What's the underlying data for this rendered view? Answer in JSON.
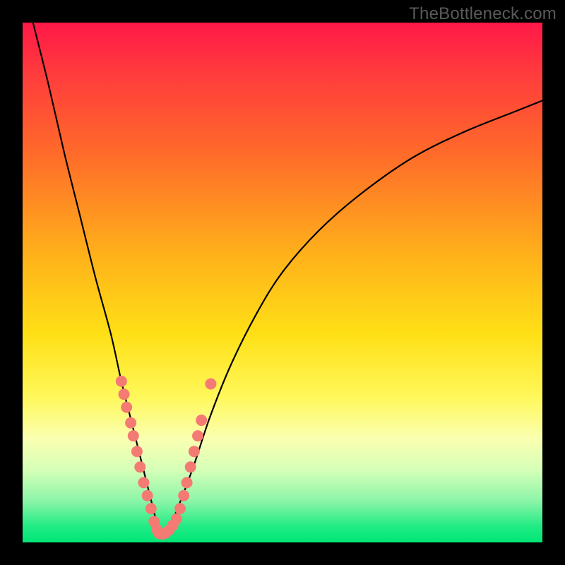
{
  "watermark": "TheBottleneck.com",
  "colors": {
    "frame": "#000000",
    "curve": "#000000",
    "dot": "#f47b73",
    "gradient_top": "#ff1848",
    "gradient_bottom": "#00e676"
  },
  "chart_data": {
    "type": "line",
    "title": "",
    "xlabel": "",
    "ylabel": "",
    "xlim": [
      0,
      100
    ],
    "ylim": [
      0,
      100
    ],
    "note": "Axes unlabeled; values below are read in percentage of plot width/height with origin at bottom-left. The curve is a V-shaped bottleneck profile with its minimum near x≈26.",
    "series": [
      {
        "name": "bottleneck-curve",
        "x": [
          2,
          5,
          8,
          11,
          14,
          17,
          19,
          21,
          23,
          25,
          26.5,
          28,
          30,
          33,
          36,
          40,
          45,
          50,
          57,
          65,
          75,
          85,
          95,
          100
        ],
        "y": [
          100,
          88,
          75,
          63,
          51,
          40,
          31,
          23,
          15,
          7,
          1.5,
          2.5,
          7,
          15,
          24,
          34,
          44,
          52,
          60,
          67,
          74,
          79,
          83,
          85
        ]
      }
    ],
    "points": [
      {
        "name": "cluster-left",
        "coords": [
          {
            "x": 19.0,
            "y": 31
          },
          {
            "x": 19.5,
            "y": 28.5
          },
          {
            "x": 20.0,
            "y": 26
          },
          {
            "x": 20.8,
            "y": 23
          },
          {
            "x": 21.3,
            "y": 20.5
          },
          {
            "x": 22.0,
            "y": 17.5
          },
          {
            "x": 22.6,
            "y": 14.5
          },
          {
            "x": 23.3,
            "y": 11.5
          },
          {
            "x": 24.0,
            "y": 9
          },
          {
            "x": 24.7,
            "y": 6.5
          }
        ]
      },
      {
        "name": "cluster-bottom",
        "coords": [
          {
            "x": 25.3,
            "y": 4
          },
          {
            "x": 25.8,
            "y": 2.5
          },
          {
            "x": 26.3,
            "y": 1.7
          },
          {
            "x": 26.9,
            "y": 1.6
          },
          {
            "x": 27.5,
            "y": 1.8
          },
          {
            "x": 28.2,
            "y": 2.4
          },
          {
            "x": 28.9,
            "y": 3.3
          },
          {
            "x": 29.6,
            "y": 4.5
          }
        ]
      },
      {
        "name": "cluster-right",
        "coords": [
          {
            "x": 30.3,
            "y": 6.5
          },
          {
            "x": 31.0,
            "y": 9
          },
          {
            "x": 31.6,
            "y": 11.5
          },
          {
            "x": 32.3,
            "y": 14.5
          },
          {
            "x": 33.0,
            "y": 17.5
          },
          {
            "x": 33.7,
            "y": 20.5
          },
          {
            "x": 34.4,
            "y": 23.5
          },
          {
            "x": 36.2,
            "y": 30.5
          }
        ]
      }
    ]
  }
}
